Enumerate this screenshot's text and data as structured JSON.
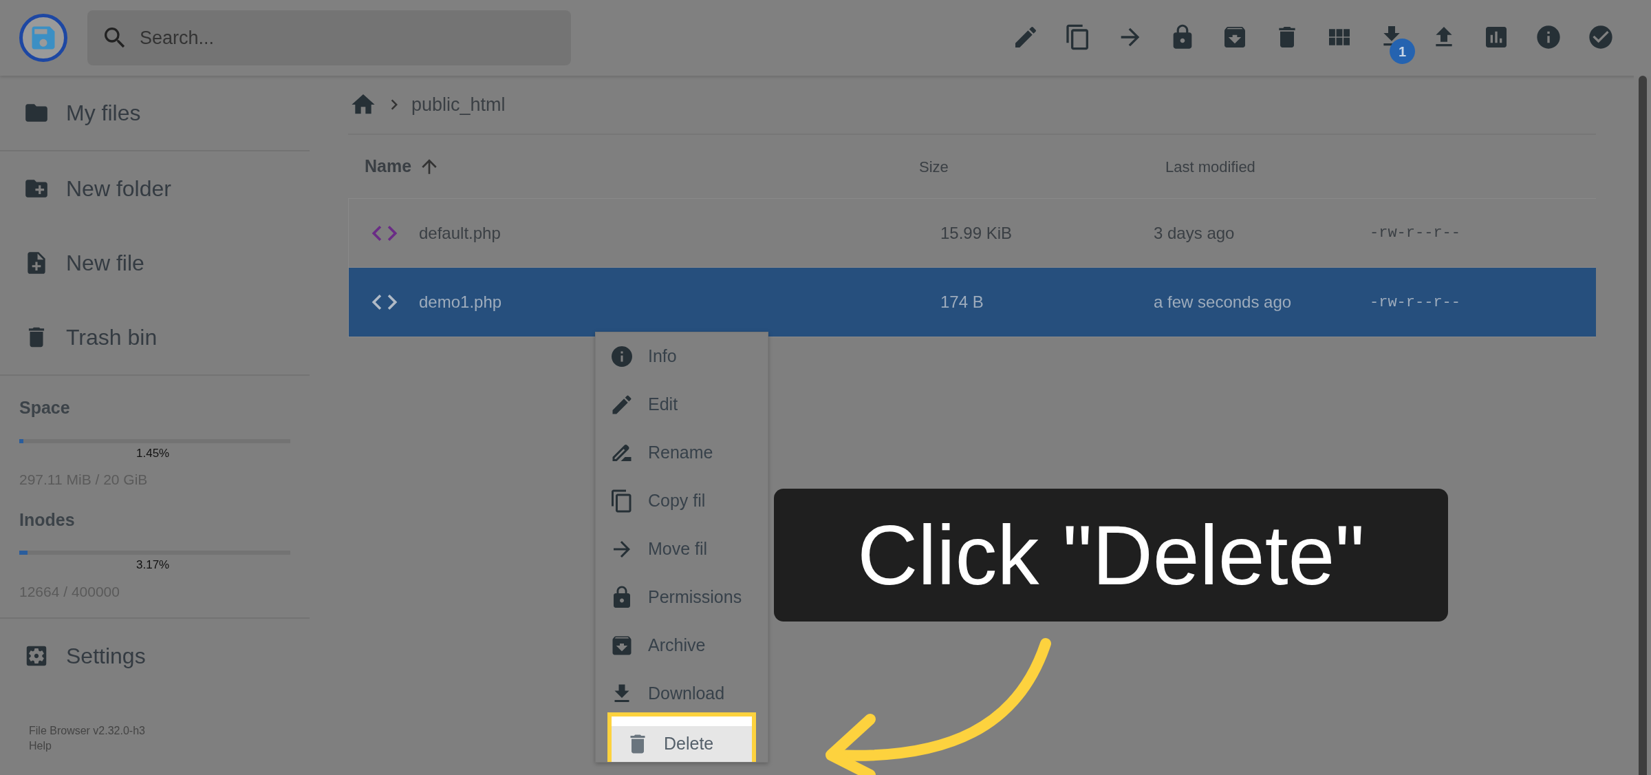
{
  "header": {
    "search": {
      "placeholder": "Search..."
    },
    "download_badge": "1"
  },
  "sidebar": {
    "groups": [
      [
        {
          "label": "My files"
        }
      ],
      [
        {
          "label": "New folder"
        },
        {
          "label": "New file"
        },
        {
          "label": "Trash bin"
        }
      ]
    ],
    "usage": [
      {
        "label": "Space",
        "level": 0.0145,
        "percent": "1.45%",
        "detail": "297.11 MiB / 20 GiB"
      },
      {
        "label": "Inodes",
        "level": 0.0317,
        "percent": "3.17%",
        "detail": "12664 / 400000"
      }
    ],
    "settings": "Settings",
    "footer": [
      "File Browser v2.32.0-h3",
      "Help"
    ]
  },
  "breadcrumb": [
    "public_html"
  ],
  "table": {
    "columns": [
      {
        "label": "Name",
        "sorted": true
      },
      {
        "label": "Size",
        "sorted": false
      },
      {
        "label": "Last modified",
        "sorted": false
      }
    ],
    "rows": [
      {
        "name": "default.php",
        "size": "15.99 KiB",
        "modified": "3 days ago",
        "permissions": "-rw-r--r--",
        "selected": false
      },
      {
        "name": "demo1.php",
        "size": "174 B",
        "modified": "a few seconds ago",
        "permissions": "-rw-r--r--",
        "selected": true
      }
    ]
  },
  "context_menu": {
    "items": [
      {
        "label": "Info",
        "highlighted": false
      },
      {
        "label": "Edit",
        "highlighted": false
      },
      {
        "label": "Rename",
        "highlighted": false
      },
      {
        "label": "Copy fil",
        "highlighted": false
      },
      {
        "label": "Move fil",
        "highlighted": false
      },
      {
        "label": "Permissions",
        "highlighted": false
      },
      {
        "label": "Archive",
        "highlighted": false
      },
      {
        "label": "Download",
        "highlighted": false
      },
      {
        "label": "Delete",
        "highlighted": true
      }
    ]
  },
  "callout": {
    "text": "Click \"Delete\""
  }
}
